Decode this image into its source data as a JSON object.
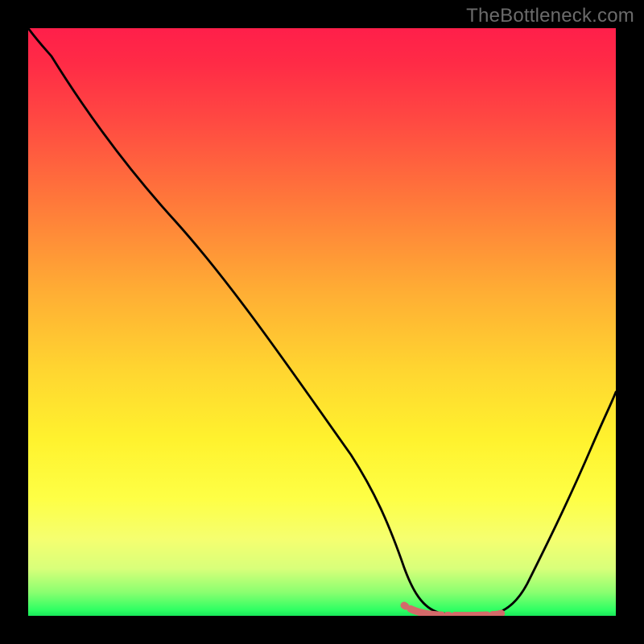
{
  "attribution": "TheBottleneck.com",
  "chart_data": {
    "type": "line",
    "title": "",
    "xlabel": "",
    "ylabel": "",
    "xlim": [
      0,
      100
    ],
    "ylim": [
      0,
      100
    ],
    "series": [
      {
        "name": "bottleneck-curve",
        "x": [
          0,
          4,
          12,
          25,
          40,
          55,
          60,
          64,
          68,
          72,
          76,
          80,
          84,
          92,
          100
        ],
        "values": [
          100,
          96,
          85,
          67,
          47,
          27,
          16,
          8,
          2,
          0,
          0,
          0,
          3,
          18,
          38
        ]
      }
    ],
    "flat_region_x": [
      63,
      80
    ],
    "annotations": []
  },
  "colors": {
    "curve": "#000000",
    "flat_marker": "#d46a6a",
    "gradient_top": "#ff1f4a",
    "gradient_bottom": "#18e85a",
    "frame": "#000000"
  }
}
